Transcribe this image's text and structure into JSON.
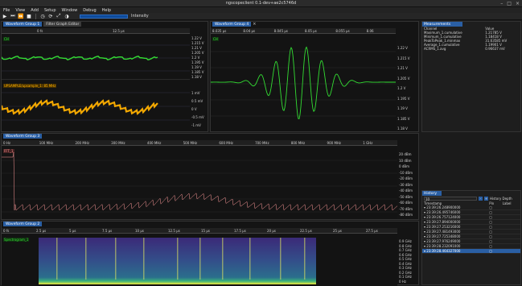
{
  "window": {
    "title": "ngscopeclient 0.1-dev+ae2c5746d"
  },
  "menu": [
    "File",
    "View",
    "Add",
    "Setup",
    "Window",
    "Debug",
    "Help"
  ],
  "toolbar": {
    "intensity_label": "Intensity"
  },
  "group1": {
    "tabs": [
      "Waveform Group 1",
      "Filter Graph Editor"
    ],
    "ruler": [
      "0 fs",
      "12.5 µs"
    ],
    "ch_label": "CH",
    "ch_color": "#33dd33",
    "ch_axis": [
      "1.22 V",
      "1.215 V",
      "1.21 V",
      "1.205 V",
      "1.2 V",
      "1.195 V",
      "1.19 V",
      "1.185 V",
      "1.18 V"
    ],
    "upsample_label": "UPSAMPLE/upsample_1: 85 MHz",
    "upsample_color": "#ffb000",
    "up_axis": [
      "1 mV",
      "0.5 mV",
      "0 V",
      "-0.5 mV",
      "-1 mV"
    ]
  },
  "group4": {
    "tab": "Waveform Group 4",
    "ruler": [
      "8.035 µs",
      "8.04 µs",
      "8.045 µs",
      "8.05 µs",
      "8.055 µs",
      "8.06"
    ],
    "ch_label": "CH",
    "axis": [
      "1.22 V",
      "1.215 V",
      "1.21 V",
      "1.205 V",
      "1.2 V",
      "1.195 V",
      "1.19 V",
      "1.185 V",
      "1.18 V"
    ]
  },
  "group3": {
    "tab": "Waveform Group 3",
    "ruler": [
      "0 Hz",
      "100 MHz",
      "200 MHz",
      "300 MHz",
      "400 MHz",
      "500 MHz",
      "600 MHz",
      "700 MHz",
      "800 MHz",
      "900 MHz",
      "1 GHz"
    ],
    "fft_label": "FFT_1",
    "fft_color": "#ff9090",
    "axis": [
      "20 dBm",
      "10 dBm",
      "0 dBm",
      "-10 dBm",
      "-20 dBm",
      "-30 dBm",
      "-40 dBm",
      "-50 dBm",
      "-60 dBm",
      "-70 dBm",
      "-80 dBm"
    ]
  },
  "group2": {
    "tab": "Waveform Group 2",
    "ruler": [
      "0 fs",
      "2.5 µs",
      "5 µs",
      "7.5 µs",
      "10 µs",
      "12.5 µs",
      "15 µs",
      "17.5 µs",
      "20 µs",
      "22.5 µs",
      "25 µs",
      "27.5 µs"
    ],
    "spec_label": "Spectrogram_1",
    "axis": [
      "0.9 GHz",
      "0.8 GHz",
      "0.7 GHz",
      "0.6 GHz",
      "0.5 GHz",
      "0.4 GHz",
      "0.3 GHz",
      "0.2 GHz",
      "0.1 GHz",
      "0 Hz"
    ]
  },
  "measurements": {
    "title": "Measurements",
    "headers": [
      "Channel",
      "Value"
    ],
    "rows": [
      [
        "Maximum_1.cumulative",
        "1.21785 V"
      ],
      [
        "Minimum_1.cumulative",
        "1.18418 V"
      ],
      [
        "PeakToPeak_1.minmax",
        "31.63585 mV"
      ],
      [
        "Average_1.cumulative",
        "1.19901 V"
      ],
      [
        "ACRMS_1.avg",
        "0.96637 mV"
      ]
    ]
  },
  "history": {
    "title": "History",
    "depth_label": "History Depth",
    "depth_value": "10",
    "headers": [
      "Timestamp",
      "Pin",
      "Label"
    ],
    "rows": [
      "23:39:26.248900000",
      "23:39:26.495746000",
      "23:39:26.757124000",
      "23:39:27.894000000",
      "23:39:27.253216000",
      "23:39:27.481493000",
      "23:39:27.725348000",
      "23:39:27.976249000",
      "23:39:28.232091000",
      "23:39:28.464327000"
    ]
  }
}
